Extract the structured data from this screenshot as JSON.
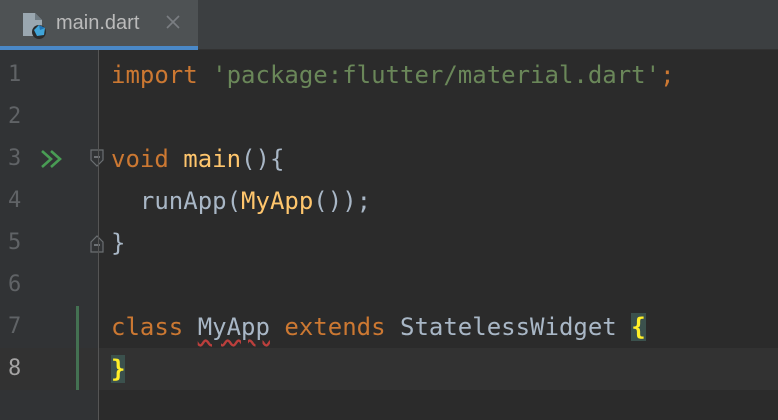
{
  "tab": {
    "file_name": "main.dart",
    "icon": "dart-file-icon",
    "close_icon": "close-icon"
  },
  "colors": {
    "keyword": "#cc7832",
    "string": "#6a8759",
    "function": "#ffc66d",
    "plain": "#a9b7c6",
    "brace_highlight": "#ffef28",
    "run": "#499c54",
    "tab_underline": "#4a88c7"
  },
  "editor": {
    "current_line": 8,
    "lines": [
      {
        "number": "1",
        "tokens": [
          {
            "t": "import",
            "c": "kw"
          },
          {
            "t": " ",
            "c": "plain"
          },
          {
            "t": "'package:flutter/material.dart'",
            "c": "str"
          },
          {
            "t": ";",
            "c": "punc-orange"
          }
        ]
      },
      {
        "number": "2",
        "tokens": []
      },
      {
        "number": "3",
        "gutter_icon": "run-icon",
        "fold": "fold-open-icon",
        "tokens": [
          {
            "t": "void",
            "c": "kw"
          },
          {
            "t": " ",
            "c": "plain"
          },
          {
            "t": "main",
            "c": "fn"
          },
          {
            "t": "(){",
            "c": "plain"
          }
        ]
      },
      {
        "number": "4",
        "tokens": [
          {
            "t": "  runApp(",
            "c": "plain"
          },
          {
            "t": "MyApp",
            "c": "fn"
          },
          {
            "t": "());",
            "c": "plain"
          }
        ]
      },
      {
        "number": "5",
        "fold": "fold-close-icon",
        "tokens": [
          {
            "t": "}",
            "c": "plain"
          }
        ]
      },
      {
        "number": "6",
        "tokens": []
      },
      {
        "number": "7",
        "tokens": [
          {
            "t": "class",
            "c": "kw"
          },
          {
            "t": " ",
            "c": "plain"
          },
          {
            "t": "MyApp",
            "c": "plain underline-wavy"
          },
          {
            "t": " ",
            "c": "plain"
          },
          {
            "t": "extends",
            "c": "kw"
          },
          {
            "t": " StatelessWidget ",
            "c": "plain"
          },
          {
            "t": "{",
            "c": "brace-hl"
          }
        ]
      },
      {
        "number": "8",
        "tokens": [
          {
            "t": "}",
            "c": "brace-hl"
          }
        ]
      }
    ]
  }
}
